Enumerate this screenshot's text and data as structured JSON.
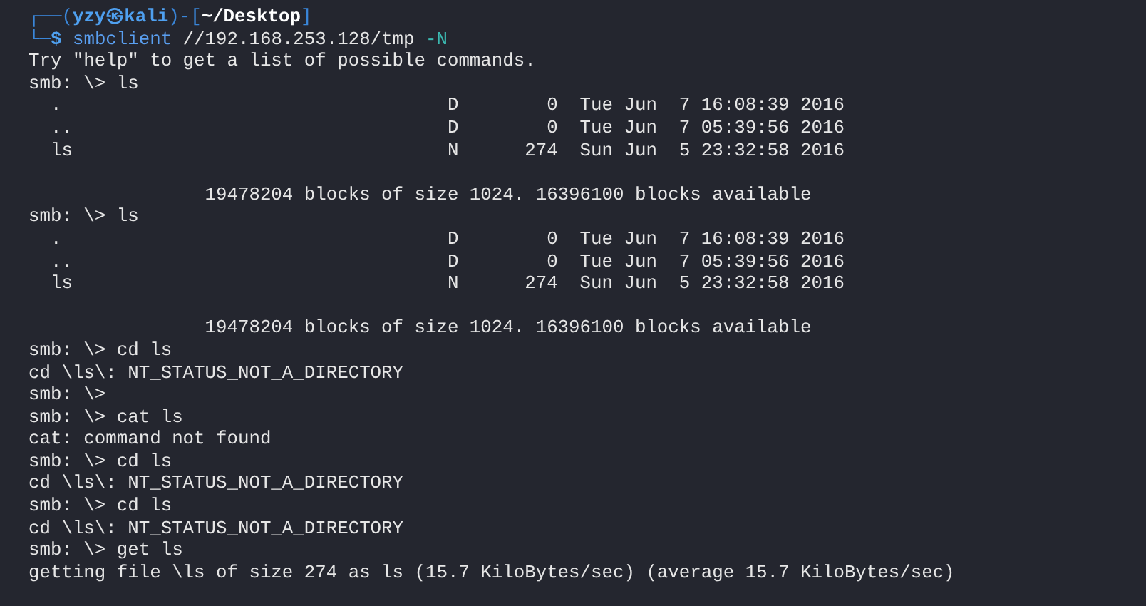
{
  "terminal": {
    "lines": [
      {
        "kind": "prompt",
        "parts": [
          {
            "kind": "frame",
            "text": "┌──("
          },
          {
            "kind": "user",
            "text": "yzy㉿kali"
          },
          {
            "kind": "frame",
            "text": ")-["
          },
          {
            "kind": "path",
            "text": "~/Desktop"
          },
          {
            "kind": "frame",
            "text": "]"
          }
        ]
      },
      {
        "kind": "prompt",
        "parts": [
          {
            "kind": "frame",
            "text": "└─"
          },
          {
            "kind": "user",
            "text": "$ "
          },
          {
            "kind": "command",
            "text": "smbclient"
          },
          {
            "kind": "plain",
            "text": " //192.168.253.128/tmp "
          },
          {
            "kind": "option",
            "text": "-N"
          }
        ]
      },
      {
        "kind": "output",
        "text": "Try \"help\" to get a list of possible commands."
      },
      {
        "kind": "output",
        "text": "smb: \\> ls"
      },
      {
        "kind": "output",
        "text": "  .                                   D        0  Tue Jun  7 16:08:39 2016"
      },
      {
        "kind": "output",
        "text": "  ..                                  D        0  Tue Jun  7 05:39:56 2016"
      },
      {
        "kind": "output",
        "text": "  ls                                  N      274  Sun Jun  5 23:32:58 2016"
      },
      {
        "kind": "blank"
      },
      {
        "kind": "output",
        "text": "                19478204 blocks of size 1024. 16396100 blocks available"
      },
      {
        "kind": "output",
        "text": "smb: \\> ls"
      },
      {
        "kind": "output",
        "text": "  .                                   D        0  Tue Jun  7 16:08:39 2016"
      },
      {
        "kind": "output",
        "text": "  ..                                  D        0  Tue Jun  7 05:39:56 2016"
      },
      {
        "kind": "output",
        "text": "  ls                                  N      274  Sun Jun  5 23:32:58 2016"
      },
      {
        "kind": "blank"
      },
      {
        "kind": "output",
        "text": "                19478204 blocks of size 1024. 16396100 blocks available"
      },
      {
        "kind": "output",
        "text": "smb: \\> cd ls"
      },
      {
        "kind": "output",
        "text": "cd \\ls\\: NT_STATUS_NOT_A_DIRECTORY"
      },
      {
        "kind": "output",
        "text": "smb: \\>"
      },
      {
        "kind": "output",
        "text": "smb: \\> cat ls"
      },
      {
        "kind": "output",
        "text": "cat: command not found"
      },
      {
        "kind": "output",
        "text": "smb: \\> cd ls"
      },
      {
        "kind": "output",
        "text": "cd \\ls\\: NT_STATUS_NOT_A_DIRECTORY"
      },
      {
        "kind": "output",
        "text": "smb: \\> cd ls"
      },
      {
        "kind": "output",
        "text": "cd \\ls\\: NT_STATUS_NOT_A_DIRECTORY"
      },
      {
        "kind": "output",
        "text": "smb: \\> get ls"
      },
      {
        "kind": "output",
        "text": "getting file \\ls of size 274 as ls (15.7 KiloBytes/sec) (average 15.7 KiloBytes/sec)"
      }
    ]
  }
}
